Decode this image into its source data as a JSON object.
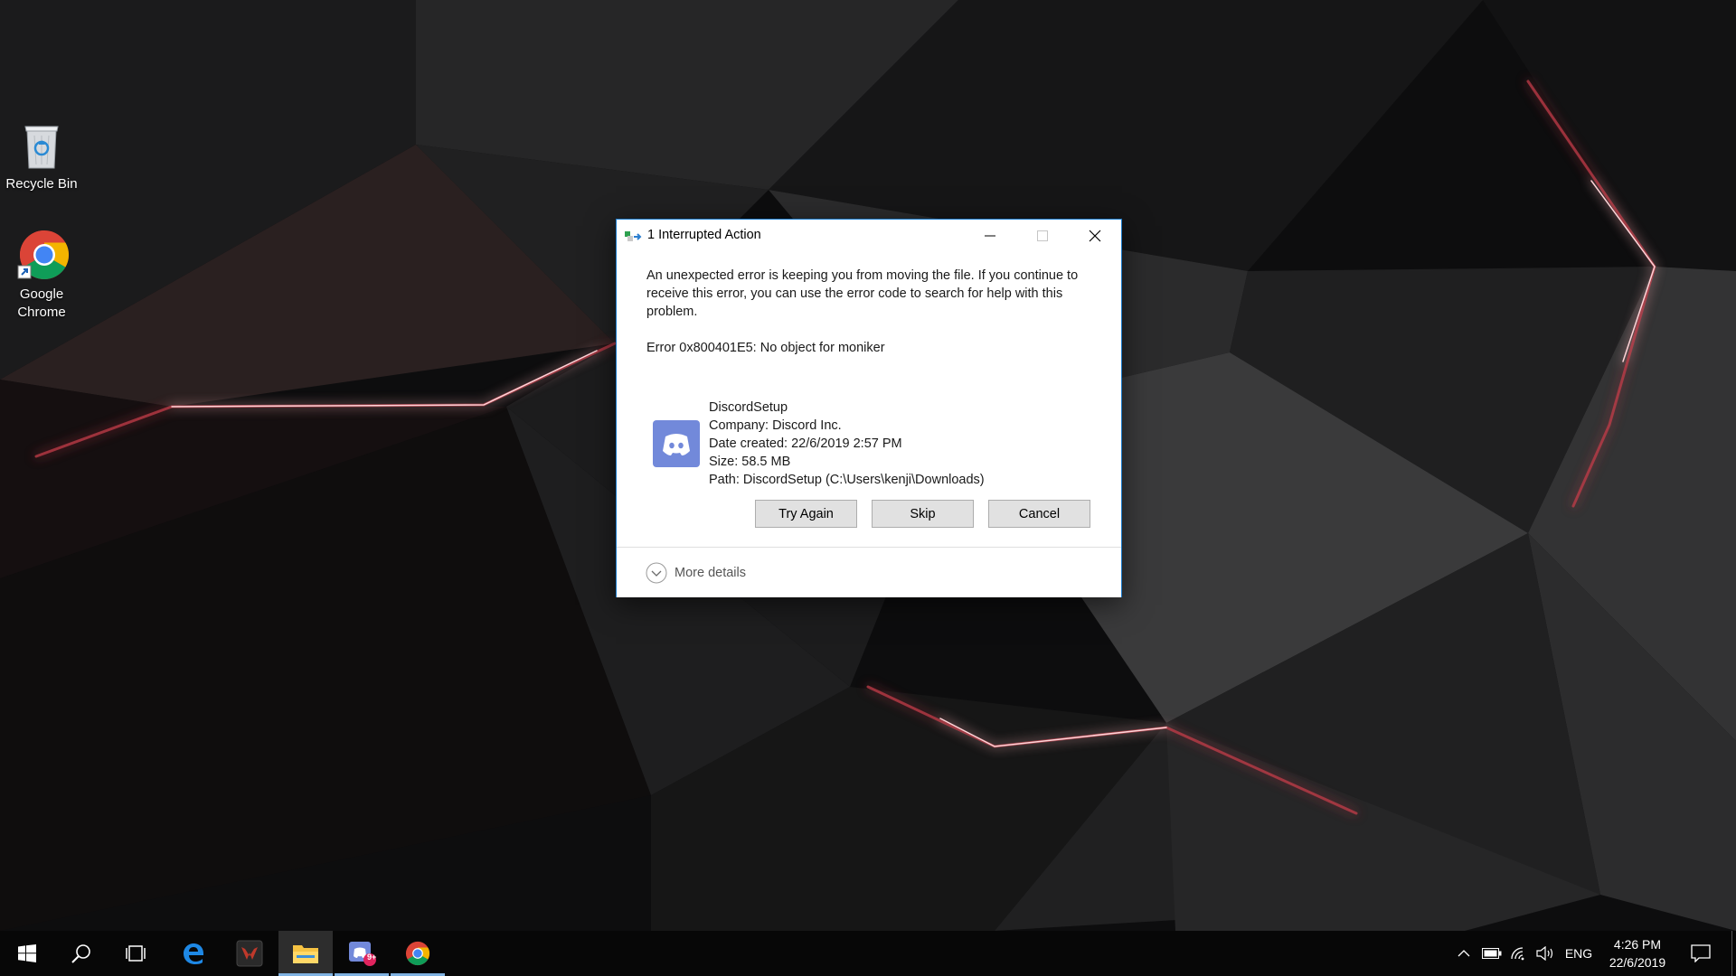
{
  "desktop": {
    "icons": [
      {
        "label": "Recycle Bin"
      },
      {
        "label": "Google Chrome"
      }
    ]
  },
  "dialog": {
    "title": "1 Interrupted Action",
    "message": "An unexpected error is keeping you from moving the file. If you continue to receive this error, you can use the error code to search for help with this problem.",
    "error": "Error 0x800401E5: No object for moniker",
    "file": {
      "name": "DiscordSetup",
      "company": "Company: Discord Inc.",
      "date_created": "Date created: 22/6/2019 2:57 PM",
      "size": "Size: 58.5 MB",
      "path": "Path: DiscordSetup (C:\\Users\\kenji\\Downloads)"
    },
    "buttons": {
      "try_again": "Try Again",
      "skip": "Skip",
      "cancel": "Cancel"
    },
    "more_details": "More details"
  },
  "taskbar": {
    "apps": [
      "start-icon",
      "search-icon",
      "task-view-icon",
      "edge-icon",
      "predator-icon",
      "file-explorer-icon",
      "discord-installer-icon",
      "chrome-icon"
    ],
    "badge": "9+",
    "language": "ENG",
    "time": "4:26 PM",
    "date": "22/6/2019"
  },
  "colors": {
    "accent": "#1979ca",
    "discord": "#7289da",
    "taskbar": "#070707",
    "active_indicator": "#7fb2e2",
    "wallpaper_glow": "#ff5a6e"
  }
}
